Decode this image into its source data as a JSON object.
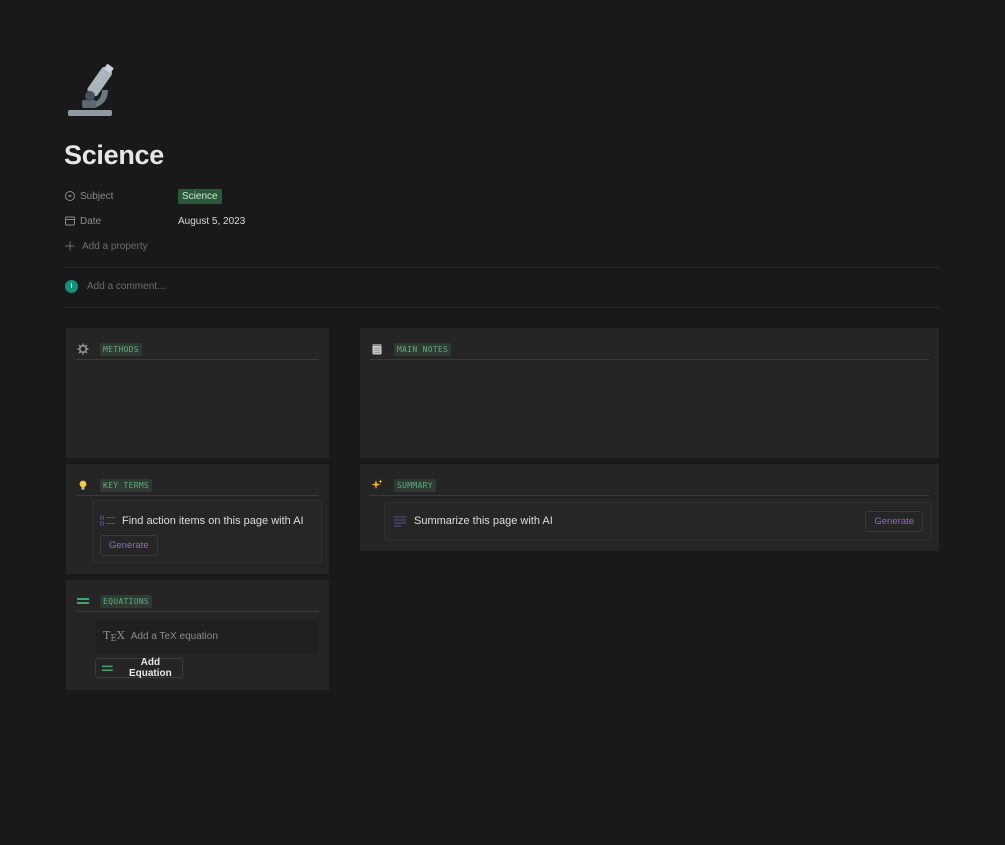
{
  "page": {
    "icon": "microscope-icon",
    "title": "Science"
  },
  "properties": [
    {
      "label": "Subject",
      "icon": "select-icon",
      "value": "Science",
      "tag_color": "#2b5a3b"
    },
    {
      "label": "Date",
      "icon": "calendar-icon",
      "value": "August 5, 2023"
    }
  ],
  "add_property_label": "Add a property",
  "comment": {
    "avatar_initial": "I",
    "placeholder": "Add a comment..."
  },
  "panels": {
    "methods": {
      "icon": "gear-icon",
      "label": "METHODS"
    },
    "main_notes": {
      "icon": "notepad-icon",
      "label": "MAIN NOTES"
    },
    "key_terms": {
      "icon": "lightbulb-icon",
      "label": "KEY TERMS",
      "ai_text": "Find action items on this page with AI",
      "button": "Generate"
    },
    "summary": {
      "icon": "sparkles-icon",
      "label": "SUMMARY",
      "ai_text": "Summarize this page with AI",
      "button": "Generate"
    },
    "equations": {
      "icon": "equals-icon",
      "label": "EQUATIONS",
      "tex_placeholder": "Add a TeX equation",
      "add_button": "Add Equation"
    }
  },
  "colors": {
    "background": "#191919",
    "panel": "#252525",
    "accent_green": "#5fae7e",
    "accent_purple": "#9167c8",
    "avatar": "#14907d"
  }
}
